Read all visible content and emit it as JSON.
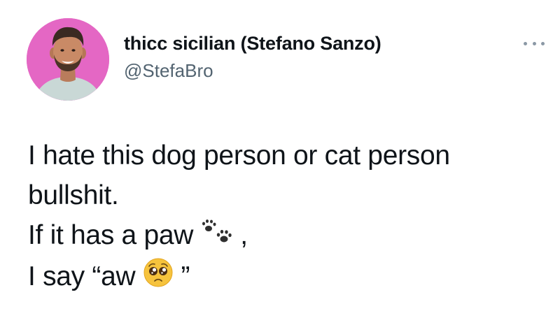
{
  "tweet": {
    "author": {
      "display_name": "thicc sicilian (Stefano Sanzo)",
      "handle": "@StefaBro",
      "avatar_bg": "#e467c4"
    },
    "more_icon": "more-horizontal-icon",
    "body": {
      "line1": "I hate this dog person or cat person",
      "line2": "bullshit.",
      "line3_text": "If it has a paw",
      "line3_emoji": "paw-prints-emoji",
      "line3_suffix": ",",
      "line4_text": "I say “aw",
      "line4_emoji": "pleading-face-emoji",
      "line4_suffix": "”"
    }
  }
}
